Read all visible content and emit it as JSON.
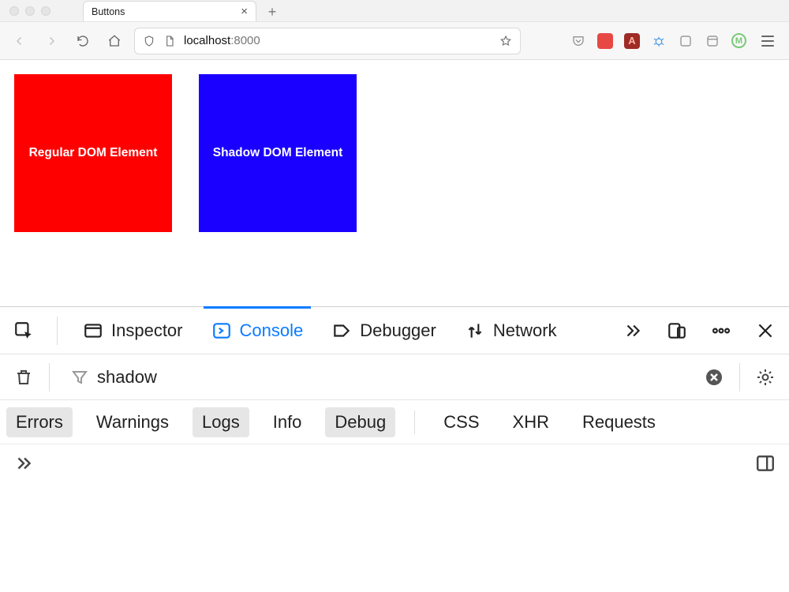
{
  "window": {
    "tab_title": "Buttons"
  },
  "toolbar": {
    "url_host": "localhost",
    "url_port": ":8000"
  },
  "page": {
    "red_square_label": "Regular DOM Element",
    "blue_square_label": "Shadow DOM Element"
  },
  "devtools": {
    "tabs": {
      "inspector": "Inspector",
      "console": "Console",
      "debugger": "Debugger",
      "network": "Network"
    },
    "active_tab": "console",
    "filter_value": "shadow",
    "categories": {
      "errors": "Errors",
      "warnings": "Warnings",
      "logs": "Logs",
      "info": "Info",
      "debug": "Debug",
      "css": "CSS",
      "xhr": "XHR",
      "requests": "Requests"
    },
    "selected_categories": [
      "errors",
      "logs",
      "debug"
    ]
  }
}
